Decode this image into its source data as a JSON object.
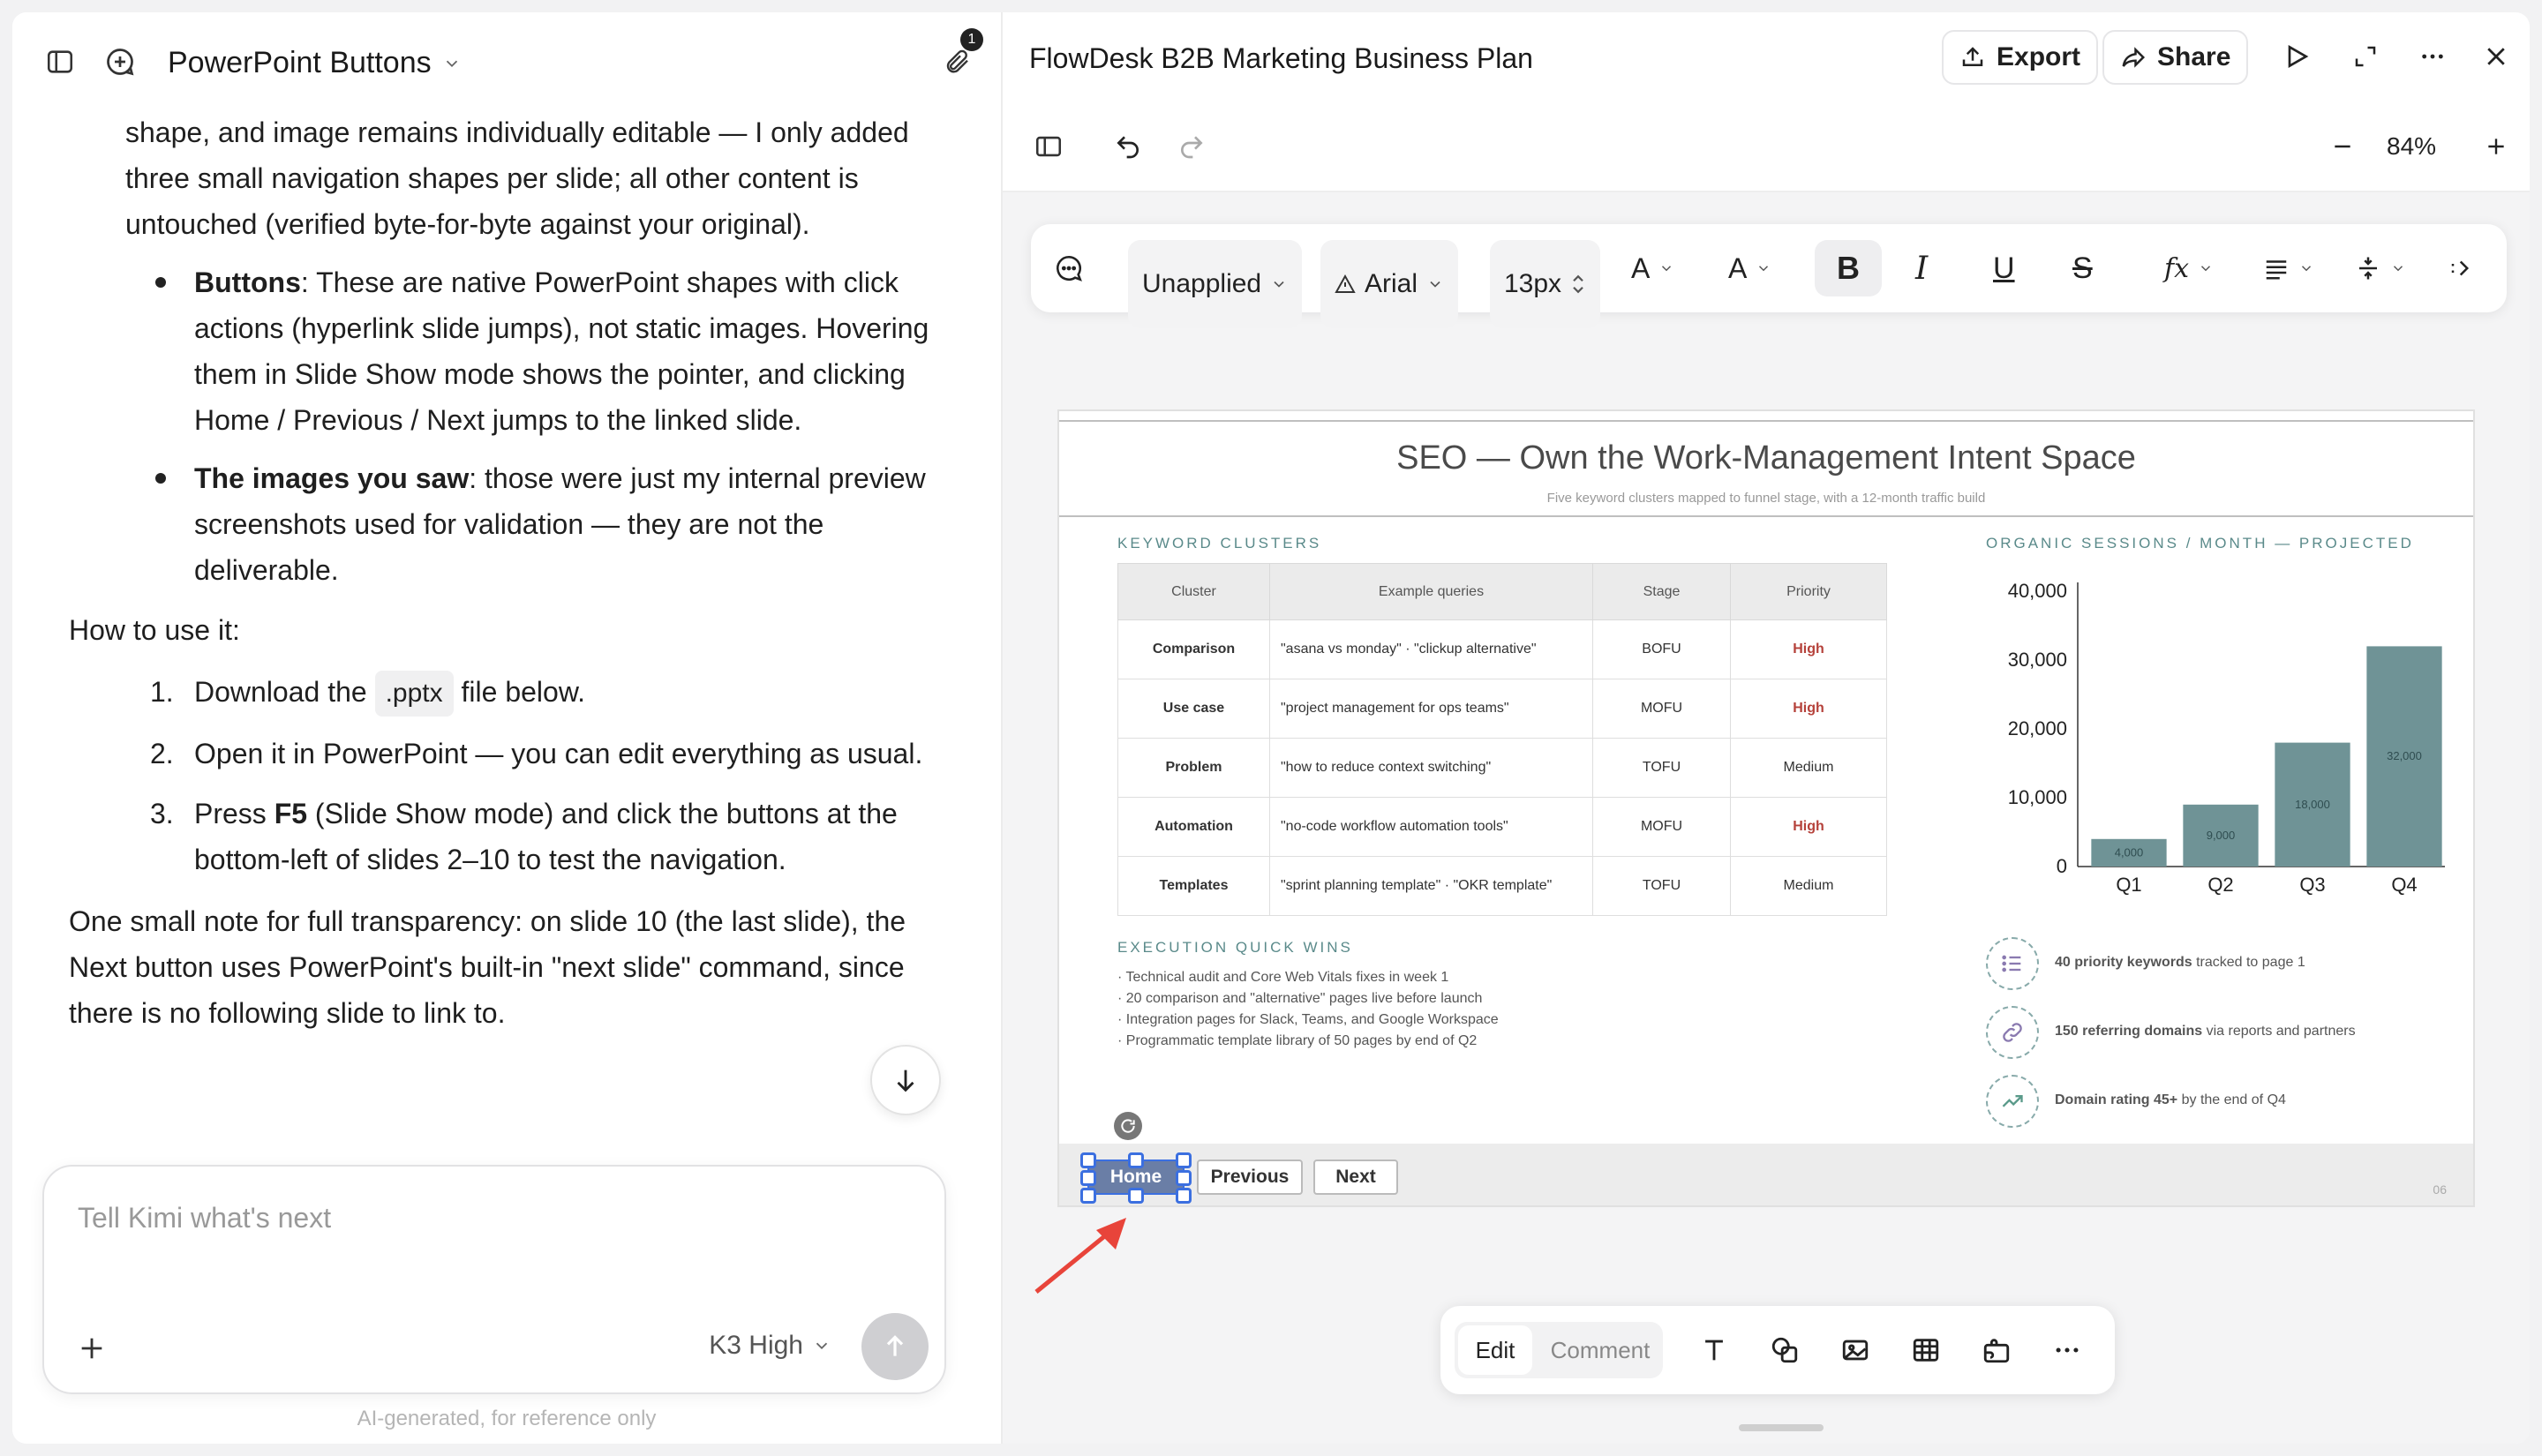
{
  "chat": {
    "title": "PowerPoint Buttons",
    "attachment_count": "1",
    "para1": "shape, and image remains individually editable — I only added three small navigation shapes per slide; all other content is untouched (verified byte-for-byte against your original).",
    "bullets": [
      {
        "bold": "Buttons",
        "text": ": These are native PowerPoint shapes with click actions (hyperlink slide jumps), not static images. Hovering them in Slide Show mode shows the pointer, and clicking Home / Previous / Next jumps to the linked slide."
      },
      {
        "bold": "The images you saw",
        "text": ": those were just my internal preview screenshots used for validation — they are not the deliverable."
      }
    ],
    "howto": "How to use it:",
    "steps": [
      {
        "n": "1.",
        "pre": "Download the",
        "code": ".pptx",
        "post": "file below."
      },
      {
        "n": "2.",
        "text": "Open it in PowerPoint — you can edit everything as usual."
      },
      {
        "n": "3.",
        "pre": "Press",
        "bold": "F5",
        "post": "(Slide Show mode) and click the buttons at the bottom-left of slides 2–10 to test the navigation."
      }
    ],
    "note": "One small note for full transparency: on slide 10 (the last slide), the Next button uses PowerPoint's built-in \"next slide\" command, since there is no following slide to link to.",
    "input_placeholder": "Tell Kimi what's next",
    "model_label": "K3 High",
    "disclaimer": "AI-generated, for reference only"
  },
  "editor": {
    "doc_title": "FlowDesk B2B Marketing Business Plan",
    "export_label": "Export",
    "share_label": "Share",
    "zoom": "84%",
    "style_select": "Unapplied",
    "font_select": "Arial",
    "size_select": "13px",
    "mode_edit": "Edit",
    "mode_comment": "Comment"
  },
  "slide": {
    "title": "SEO — Own the Work-Management Intent Space",
    "subtitle": "Five keyword clusters mapped to funnel stage, with a 12-month traffic build",
    "kw_heading": "KEYWORD CLUSTERS",
    "columns": [
      "Cluster",
      "Example queries",
      "Stage",
      "Priority"
    ],
    "rows": [
      {
        "cluster": "Comparison",
        "query": "\"asana vs monday\" · \"clickup alternative\"",
        "stage": "BOFU",
        "priority": "High",
        "high": true
      },
      {
        "cluster": "Use case",
        "query": "\"project management for ops teams\"",
        "stage": "MOFU",
        "priority": "High",
        "high": true
      },
      {
        "cluster": "Problem",
        "query": "\"how to reduce context switching\"",
        "stage": "TOFU",
        "priority": "Medium",
        "high": false
      },
      {
        "cluster": "Automation",
        "query": "\"no-code workflow automation tools\"",
        "stage": "MOFU",
        "priority": "High",
        "high": true
      },
      {
        "cluster": "Templates",
        "query": "\"sprint planning template\" · \"OKR template\"",
        "stage": "TOFU",
        "priority": "Medium",
        "high": false
      }
    ],
    "wins_heading": "EXECUTION QUICK WINS",
    "wins": [
      "· Technical audit and Core Web Vitals fixes in week 1",
      "· 20 comparison and \"alternative\" pages live before launch",
      "· Integration pages for Slack, Teams, and Google Workspace",
      "· Programmatic template library of 50 pages by end of Q2"
    ],
    "chart_heading": "ORGANIC SESSIONS / MONTH — PROJECTED",
    "metrics": [
      {
        "bold": "40 priority keywords",
        "rest": " tracked to page 1"
      },
      {
        "bold": "150 referring domains",
        "rest": " via reports and partners"
      },
      {
        "bold": "Domain rating 45+",
        "rest": " by the end of Q4"
      }
    ],
    "nav": {
      "home": "Home",
      "previous": "Previous",
      "next": "Next"
    },
    "page_number": "06"
  },
  "chart_data": {
    "type": "bar",
    "title": "ORGANIC SESSIONS / MONTH — PROJECTED",
    "categories": [
      "Q1",
      "Q2",
      "Q3",
      "Q4"
    ],
    "values": [
      4000,
      9000,
      18000,
      32000
    ],
    "yticks": [
      0,
      10000,
      20000,
      30000,
      40000
    ],
    "ylim": [
      0,
      40000
    ],
    "bar_color": "#6f9396",
    "grid": false
  }
}
